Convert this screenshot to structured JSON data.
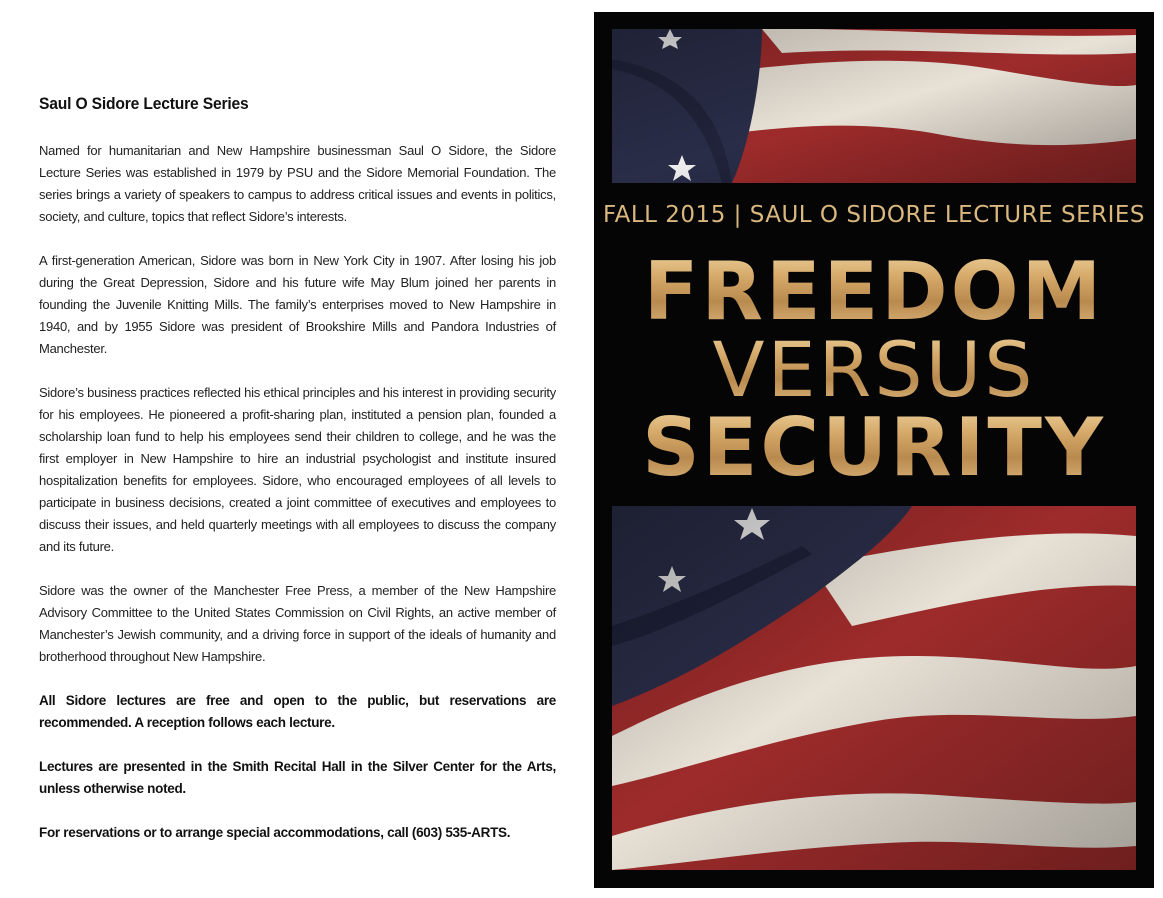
{
  "left": {
    "heading": "Saul O Sidore Lecture Series",
    "paragraphs": [
      "Named for humanitarian and New Hampshire businessman Saul O Sidore, the Sidore Lecture Series was established in 1979 by PSU and the Sidore Memorial Foundation. The series brings a variety of speakers to campus to address critical issues and events in politics, society, and culture, topics that reflect Sidore’s interests.",
      "A first-generation American, Sidore was born in New York City in 1907. After losing his job during the Great Depression, Sidore and his future wife May Blum joined her parents in founding the Juvenile Knitting Mills. The family’s enterprises moved to New Hampshire in 1940, and by 1955 Sidore was president of Brookshire Mills and Pandora Industries of Manchester.",
      "Sidore’s business practices reflected his ethical principles and his interest in providing security for his employees. He pioneered a profit-sharing plan, instituted a pension plan, founded a scholarship loan fund to help his employees send their children to college, and he was the first employer in New Hampshire to hire an industrial psychologist and institute insured hospitalization benefits for employees. Sidore, who encouraged employees of all levels to participate in business decisions, created a joint committee of executives and employees to discuss their issues, and held quarterly meetings with all employees to discuss the company and its future.",
      "Sidore was the owner of the Manchester Free Press, a member of the New Hampshire Advisory Committee to the United States Commission on Civil Rights, an active member of Manchester’s Jewish community, and a driving force in support of the ideals of humanity and brotherhood throughout New Hampshire."
    ],
    "bold_paragraphs": [
      "All Sidore lectures are free and open to the public, but reservations are recommended. A reception follows each lecture.",
      "Lectures are presented in the Smith Recital Hall in the Silver Center for the Arts, unless otherwise noted.",
      "For reservations or to arrange special accommodations, call (603) 535-ARTS."
    ]
  },
  "cover": {
    "series_line": "FALL 2015 | SAUL O SIDORE LECTURE SERIES",
    "title_line_1": "FREEDOM",
    "title_line_2": "VERSUS",
    "title_line_3": "SECURITY",
    "colors": {
      "background": "#050505",
      "gold": "#d9b77e",
      "flag_red": "#9e2b2b",
      "flag_white": "#e8e1d6",
      "flag_blue": "#2a2d48"
    },
    "images": [
      "american-flag-photo-top",
      "american-flag-photo-bottom"
    ]
  }
}
